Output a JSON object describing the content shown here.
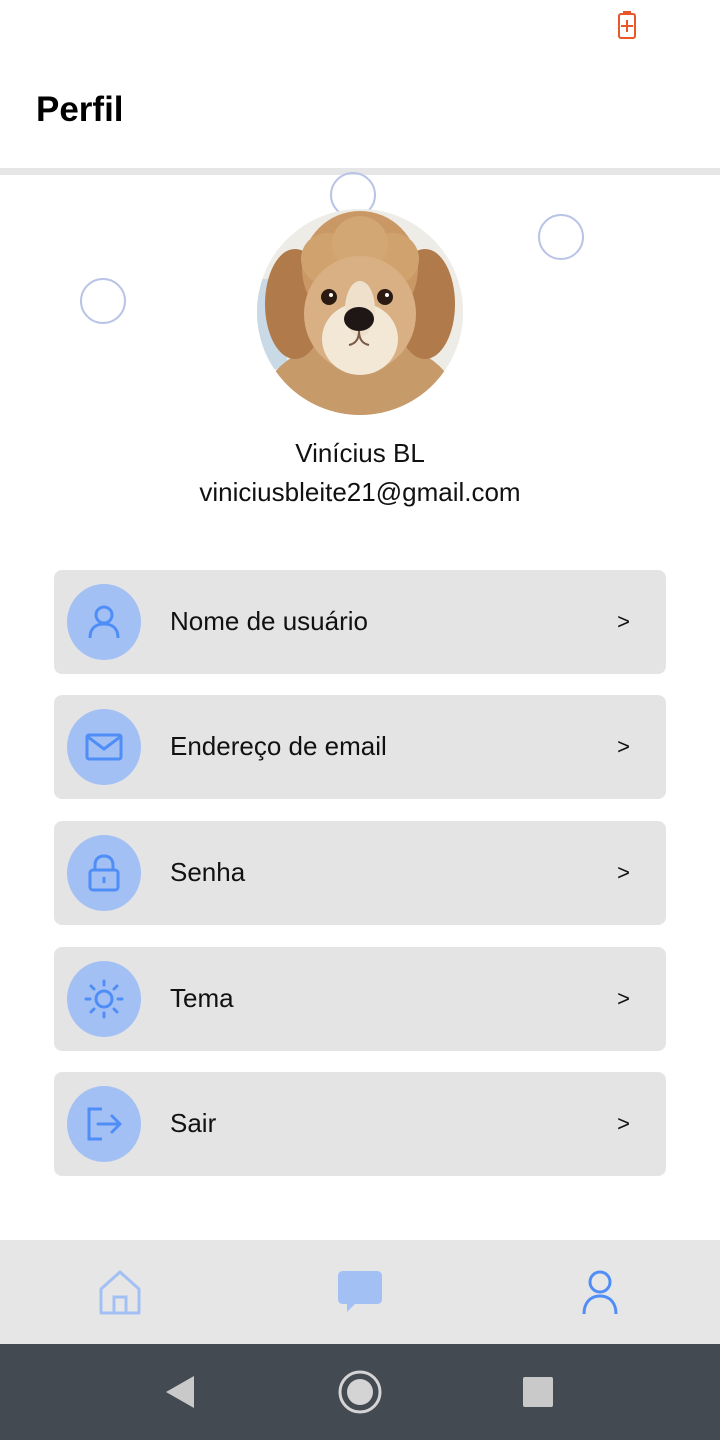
{
  "status_bar": {
    "icons": [
      "battery-charging-icon"
    ],
    "colors": {
      "battery": "#e8562a"
    }
  },
  "header": {
    "title": "Perfil"
  },
  "profile": {
    "avatar": "dog-avatar",
    "name": "Vinícius BL",
    "email": "viniciusbleite21@gmail.com"
  },
  "menu": {
    "items": [
      {
        "label": "Nome de usuário",
        "icon": "user-icon",
        "chevron": ">"
      },
      {
        "label": "Endereço de email",
        "icon": "mail-icon",
        "chevron": ">"
      },
      {
        "label": "Senha",
        "icon": "lock-icon",
        "chevron": ">"
      },
      {
        "label": "Tema",
        "icon": "sun-icon",
        "chevron": ">"
      },
      {
        "label": "Sair",
        "icon": "logout-icon",
        "chevron": ">"
      }
    ]
  },
  "bottom_nav": {
    "items": [
      {
        "icon": "home-icon",
        "active": false
      },
      {
        "icon": "chat-icon",
        "active": false
      },
      {
        "icon": "profile-icon",
        "active": true
      }
    ]
  },
  "system_nav": {
    "buttons": [
      "back-icon",
      "home-circle-icon",
      "recents-icon"
    ]
  },
  "colors": {
    "accent": "#4f8ef7",
    "icon_circle": "#a3c0f5",
    "menu_bg": "#e4e4e4",
    "nav_bg": "#e6e6e6",
    "system_nav_bg": "#444a52"
  }
}
